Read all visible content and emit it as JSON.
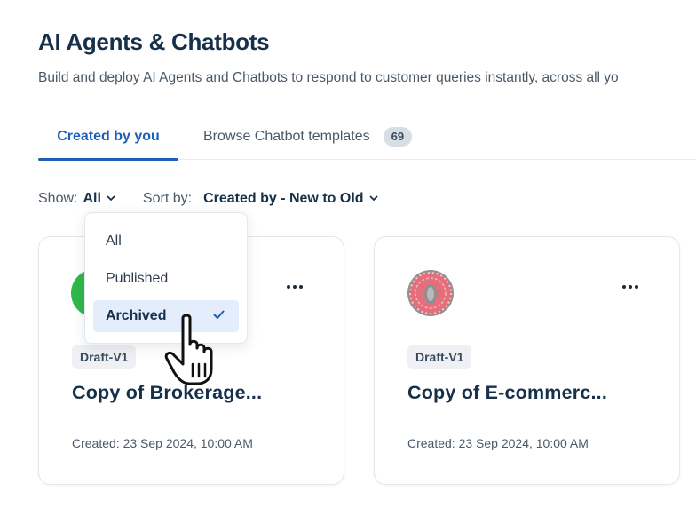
{
  "header": {
    "title": "AI Agents & Chatbots",
    "subtitle": "Build and deploy AI Agents and Chatbots to respond to customer queries instantly, across all yo"
  },
  "tabs": [
    {
      "label": "Created by you",
      "active": true
    },
    {
      "label": "Browse Chatbot templates",
      "count": "69",
      "active": false
    }
  ],
  "filters": {
    "show_label": "Show:",
    "show_value": "All",
    "sort_label": "Sort by:",
    "sort_value": "Created by - New to Old"
  },
  "show_dropdown": {
    "options": [
      "All",
      "Published",
      "Archived"
    ],
    "selected": "Archived"
  },
  "cards": [
    {
      "avatar": "green-avatar",
      "version": "Draft-V1",
      "title": "Copy of Brokerage...",
      "created": "Created: 23 Sep 2024, 10:00 AM"
    },
    {
      "avatar": "pink-ring-avatar",
      "version": "Draft-V1",
      "title": "Copy of E-commerc...",
      "created": "Created: 23 Sep 2024, 10:00 AM"
    }
  ],
  "colors": {
    "accent": "#1f5fb8",
    "title": "#17304a",
    "selected_bg": "#e3edfb",
    "badge_bg": "#d7dee6",
    "green_avatar": "#2fb84a",
    "pink_avatar": "#e26d79"
  },
  "icons": {
    "chevron": "chevron-down-icon",
    "check": "check-icon",
    "more": "more-horizontal-icon",
    "cursor": "hand-pointer-cursor"
  }
}
